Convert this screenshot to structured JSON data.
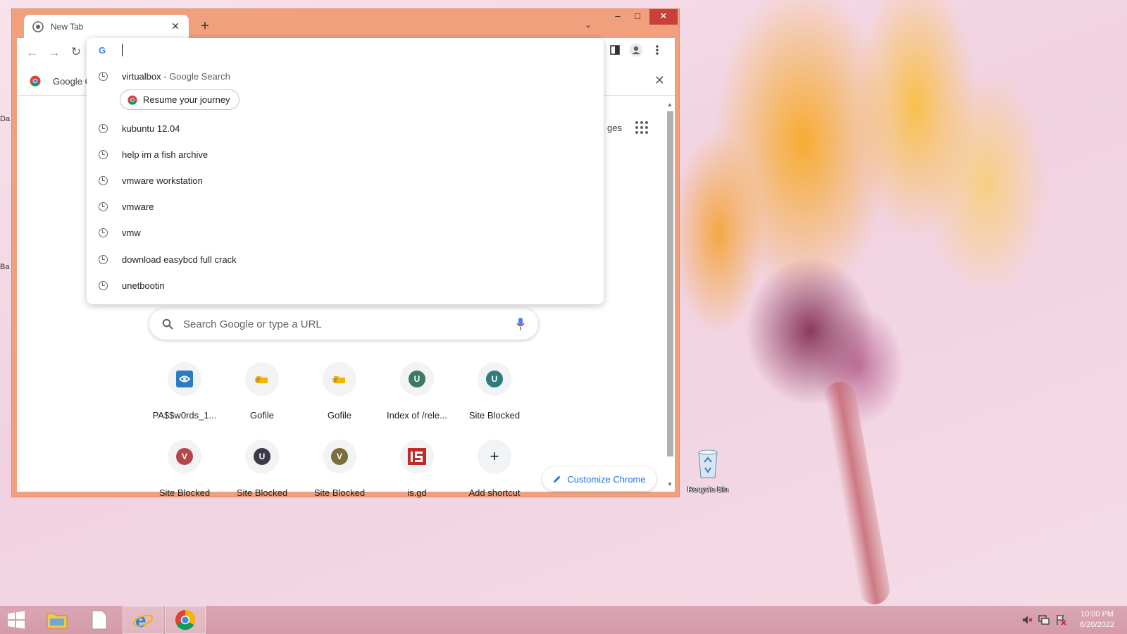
{
  "browser": {
    "tab_title": "New Tab",
    "new_tab_symbol": "+",
    "tab_close_symbol": "✕",
    "window_controls": {
      "minimize": "–",
      "maximize": "□",
      "close": "✕"
    },
    "tab_search_symbol": "⌄",
    "nav": {
      "back": "←",
      "forward": "→",
      "reload": "↻"
    }
  },
  "omnibox": {
    "g_logo": "G",
    "input_value": "",
    "suggestions": [
      {
        "text": "virtualbox",
        "subtext": " - Google Search"
      },
      {
        "text": "kubuntu 12.04"
      },
      {
        "text": "help im a fish archive"
      },
      {
        "text": "vmware workstation"
      },
      {
        "text": "vmware"
      },
      {
        "text": "vmw"
      },
      {
        "text": "download easybcd full crack"
      },
      {
        "text": "unetbootin"
      }
    ],
    "journey_chip": "Resume your journey"
  },
  "bookmarks": {
    "label": "Google C",
    "close_symbol": "✕"
  },
  "ntp": {
    "images_partial": "ges",
    "search_placeholder": "Search Google or type a URL",
    "shortcuts": [
      {
        "label": "PA$$w0rds_1...",
        "icon": "blue-arrow-icon"
      },
      {
        "label": "Gofile",
        "icon": "gofile-icon"
      },
      {
        "label": "Gofile",
        "icon": "gofile-icon"
      },
      {
        "label": "Index of /rele...",
        "letter": "U",
        "color": "#3d7a63"
      },
      {
        "label": "Site Blocked",
        "letter": "U",
        "color": "#2e7d7a"
      },
      {
        "label": "Site Blocked",
        "letter": "V",
        "color": "#b74548"
      },
      {
        "label": "Site Blocked",
        "letter": "U",
        "color": "#3b3a48"
      },
      {
        "label": "Site Blocked",
        "letter": "V",
        "color": "#7a6e3a"
      },
      {
        "label": "is.gd",
        "icon": "isgd-icon"
      },
      {
        "label": "Add shortcut",
        "symbol": "+"
      }
    ],
    "customize_label": "Customize Chrome"
  },
  "desktop": {
    "recycle_bin_label": "Recycle Bin",
    "edge_fragments": [
      "Da",
      "Ba"
    ]
  },
  "taskbar": {
    "time": "10:00 PM",
    "date": "6/20/2022"
  },
  "colors": {
    "window_frame": "#f0a07d",
    "close_button": "#c7413a",
    "accent_blue": "#1a73e8",
    "taskbar": "#d8a0ae"
  }
}
